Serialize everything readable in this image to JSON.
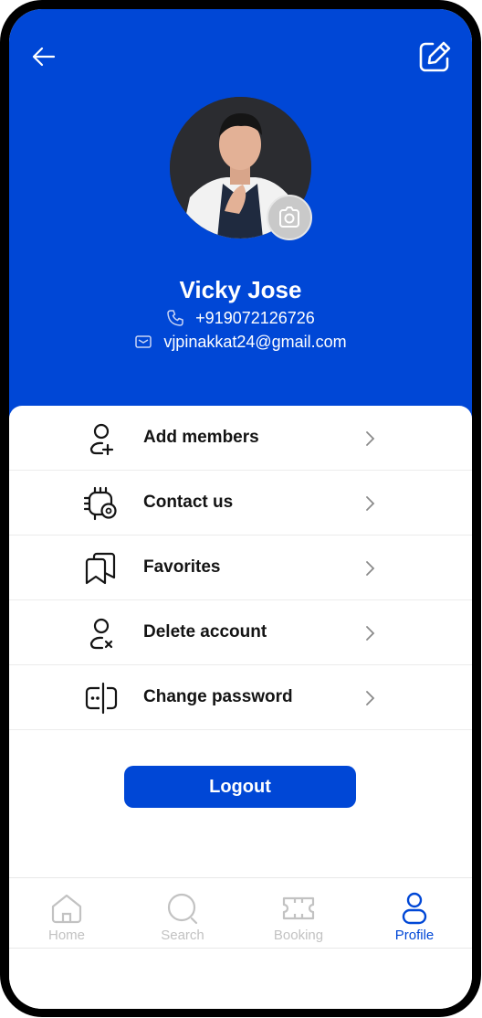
{
  "profile": {
    "name": "Vicky Jose",
    "phone": "+919072126726",
    "email": "vjpinakkat24@gmail.com"
  },
  "menu": [
    {
      "label": "Add members",
      "icon": "add-user-icon"
    },
    {
      "label": "Contact us",
      "icon": "settings-chip-icon"
    },
    {
      "label": "Favorites",
      "icon": "bookmarks-icon"
    },
    {
      "label": "Delete account",
      "icon": "remove-user-icon"
    },
    {
      "label": "Change password",
      "icon": "password-icon"
    }
  ],
  "logout_label": "Logout",
  "nav": [
    {
      "label": "Home",
      "icon": "home-icon",
      "active": false
    },
    {
      "label": "Search",
      "icon": "search-icon",
      "active": false
    },
    {
      "label": "Booking",
      "icon": "ticket-icon",
      "active": false
    },
    {
      "label": "Profile",
      "icon": "user-icon",
      "active": true
    }
  ],
  "colors": {
    "brand": "#0047d6",
    "inactive": "#c2c2c2",
    "text": "#141414"
  }
}
